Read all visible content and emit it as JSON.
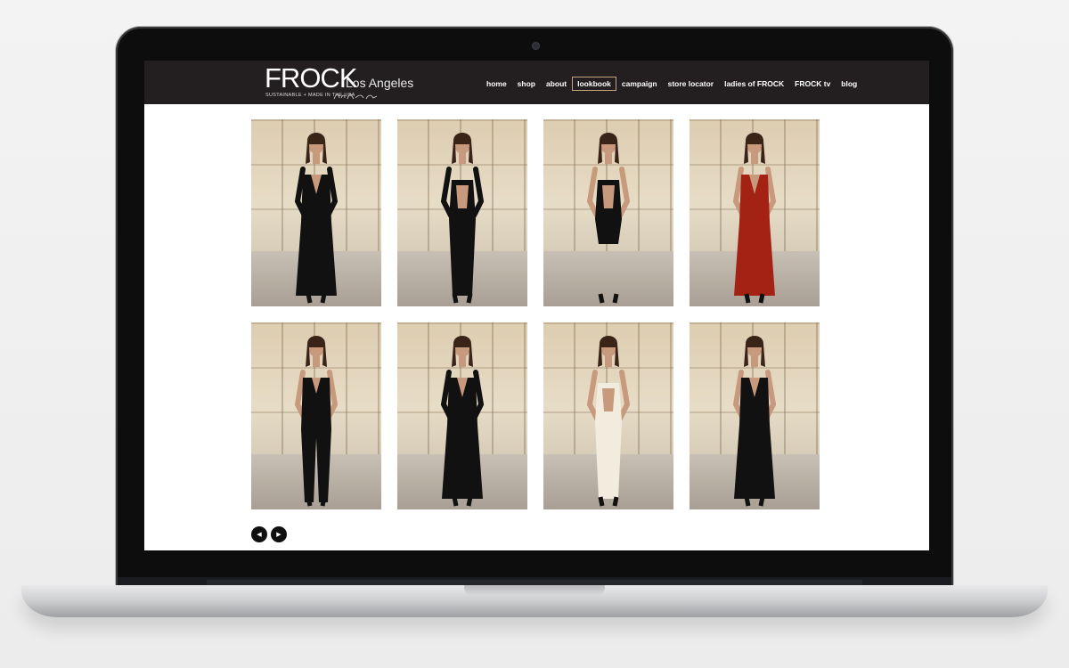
{
  "brand": {
    "name": "FROCK",
    "city": "Los Angeles",
    "tagline": "SUSTAINABLE + MADE IN THE USA"
  },
  "nav": {
    "items": [
      {
        "label": "home"
      },
      {
        "label": "shop"
      },
      {
        "label": "about"
      },
      {
        "label": "lookbook",
        "active": true
      },
      {
        "label": "campaign"
      },
      {
        "label": "store locator"
      },
      {
        "label": "ladies of FROCK"
      },
      {
        "label": "FROCK tv"
      },
      {
        "label": "blog"
      }
    ],
    "active_border_color": "#c4a27c"
  },
  "gallery": {
    "photos": [
      {
        "garment": "black side-cutout long-sleeve maxi gown",
        "color": "#111111",
        "view": "side"
      },
      {
        "garment": "black open-back long-sleeve maxi gown",
        "color": "#111111",
        "view": "back"
      },
      {
        "garment": "black cutout-back knee-length dress",
        "color": "#111111",
        "view": "back"
      },
      {
        "garment": "red wrap-front maxi gown",
        "color": "#a42214",
        "view": "front"
      },
      {
        "garment": "black v-neck jumpsuit",
        "color": "#111111",
        "view": "front"
      },
      {
        "garment": "black long-sleeve slit maxi dress",
        "color": "#111111",
        "view": "front"
      },
      {
        "garment": "ivory racerback open-back maxi gown",
        "color": "#f1ecde",
        "view": "back"
      },
      {
        "garment": "black wrap maxi dress",
        "color": "#111111",
        "view": "front"
      }
    ]
  },
  "pager": {
    "prev_icon": "chevron-left-icon",
    "next_icon": "chevron-right-icon",
    "prev_glyph": "◀",
    "next_glyph": "▶"
  },
  "colors": {
    "header_bg": "#231f20",
    "page_bg": "#ffffff"
  }
}
